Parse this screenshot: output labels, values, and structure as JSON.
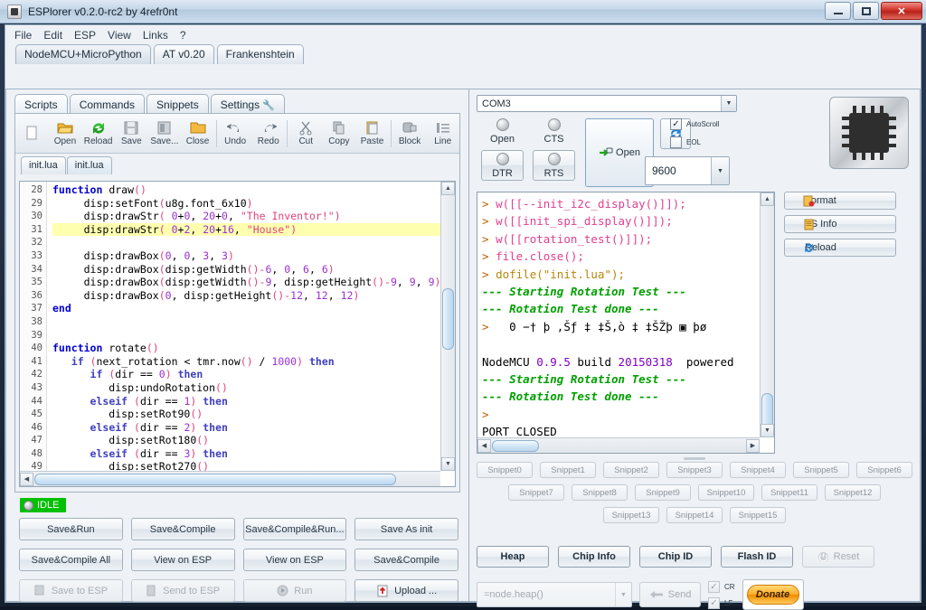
{
  "window": {
    "title": "ESPlorer v0.2.0-rc2 by 4refr0nt",
    "minimize_label": "minimize",
    "maximize_label": "maximize",
    "close_label": "✕"
  },
  "menubar": {
    "items": [
      "File",
      "Edit",
      "ESP",
      "View",
      "Links",
      "?"
    ]
  },
  "top_tabs": [
    {
      "label": "NodeMCU+MicroPython",
      "active": true
    },
    {
      "label": "AT v0.20",
      "active": false
    },
    {
      "label": "Frankenshtein",
      "active": false
    }
  ],
  "inner_tabs": [
    {
      "label": "Scripts",
      "active": true
    },
    {
      "label": "Commands",
      "active": false
    },
    {
      "label": "Snippets",
      "active": false
    },
    {
      "label": "Settings",
      "active": false,
      "icon": "wrench-icon"
    }
  ],
  "toolbar": [
    {
      "label": "",
      "icon": "new-file-icon"
    },
    {
      "label": "Open",
      "icon": "open-folder-icon"
    },
    {
      "label": "Reload",
      "icon": "reload-icon"
    },
    {
      "label": "Save",
      "icon": "save-icon"
    },
    {
      "label": "Save...",
      "icon": "save-as-icon"
    },
    {
      "label": "Close",
      "icon": "close-folder-icon"
    },
    {
      "label": "Undo",
      "icon": "undo-icon"
    },
    {
      "label": "Redo",
      "icon": "redo-icon"
    },
    {
      "label": "Cut",
      "icon": "scissors-icon"
    },
    {
      "label": "Copy",
      "icon": "copy-icon"
    },
    {
      "label": "Paste",
      "icon": "paste-icon"
    },
    {
      "label": "Block",
      "icon": "block-icon"
    },
    {
      "label": "Line",
      "icon": "line-icon"
    }
  ],
  "file_tabs": [
    {
      "label": "init.lua",
      "active": false
    },
    {
      "label": "init.lua",
      "active": true
    }
  ],
  "editor": {
    "first_line_number": 28,
    "highlight_line": 31,
    "lines": [
      {
        "n": 28,
        "text": "function draw()"
      },
      {
        "n": 29,
        "text": "     disp:setFont(u8g.font_6x10)"
      },
      {
        "n": 30,
        "text": "     disp:drawStr( 0+0, 20+0, \"The Inventor!\")"
      },
      {
        "n": 31,
        "text": "     disp:drawStr( 0+2, 20+16, \"House\")"
      },
      {
        "n": 32,
        "text": ""
      },
      {
        "n": 33,
        "text": "     disp:drawBox(0, 0, 3, 3)"
      },
      {
        "n": 34,
        "text": "     disp:drawBox(disp:getWidth()-6, 0, 6, 6)"
      },
      {
        "n": 35,
        "text": "     disp:drawBox(disp:getWidth()-9, disp:getHeight()-9, 9, 9)"
      },
      {
        "n": 36,
        "text": "     disp:drawBox(0, disp:getHeight()-12, 12, 12)"
      },
      {
        "n": 37,
        "text": "end"
      },
      {
        "n": 38,
        "text": ""
      },
      {
        "n": 39,
        "text": ""
      },
      {
        "n": 40,
        "text": "function rotate()"
      },
      {
        "n": 41,
        "text": "   if (next_rotation < tmr.now() / 1000) then"
      },
      {
        "n": 42,
        "text": "      if (dir == 0) then"
      },
      {
        "n": 43,
        "text": "         disp:undoRotation()"
      },
      {
        "n": 44,
        "text": "      elseif (dir == 1) then"
      },
      {
        "n": 45,
        "text": "         disp:setRot90()"
      },
      {
        "n": 46,
        "text": "      elseif (dir == 2) then"
      },
      {
        "n": 47,
        "text": "         disp:setRot180()"
      },
      {
        "n": 48,
        "text": "      elseif (dir == 3) then"
      },
      {
        "n": 49,
        "text": "         disp:setRot270()"
      }
    ]
  },
  "status": {
    "label": "IDLE",
    "color": "#00c000"
  },
  "action_buttons": {
    "row1": [
      "Save&Run",
      "Save&Compile",
      "Save&Compile&Run...",
      "Save As init"
    ],
    "row2": [
      "Save&Compile All",
      "View on ESP",
      "View on ESP",
      "Save&Compile"
    ],
    "row3": [
      {
        "label": "Save to ESP",
        "disabled": true,
        "icon": "save-esp-icon"
      },
      {
        "label": "Send to ESP",
        "disabled": true,
        "icon": "send-esp-icon"
      },
      {
        "label": "Run",
        "disabled": true,
        "icon": "run-icon"
      },
      {
        "label": "Upload ...",
        "disabled": false,
        "icon": "upload-icon"
      }
    ]
  },
  "serial": {
    "port": "COM3",
    "baud": "9600",
    "lamps": [
      {
        "label": "Open"
      },
      {
        "label": "CTS"
      },
      {
        "label": "DTR"
      },
      {
        "label": "RTS"
      }
    ],
    "open_button": "Open",
    "refresh_icon": "refresh-icon",
    "checkboxes": [
      {
        "label": "AutoScroll",
        "checked": true
      },
      {
        "label": "EOL",
        "checked": false
      }
    ]
  },
  "console": {
    "lines": [
      {
        "type": "cmd",
        "prompt": ">",
        "text": " w([[--init_i2c_display()]]);"
      },
      {
        "type": "cmd",
        "prompt": ">",
        "text": " w([[init_spi_display()]]);"
      },
      {
        "type": "cmd",
        "prompt": ">",
        "text": " w([[rotation_test()]]);"
      },
      {
        "type": "cmd",
        "prompt": ">",
        "text": " file.close();"
      },
      {
        "type": "cmd-str",
        "prompt": ">",
        "text": " dofile(\"init.lua\");"
      },
      {
        "type": "green",
        "text": "--- Starting Rotation Test ---"
      },
      {
        "type": "green",
        "text": "--- Rotation Test done ---"
      },
      {
        "type": "garbled",
        "prompt": ">",
        "text": "  0 −† þ ,Šƒ ‡ ‡Š‚ò ‡ ‡ŠŽþ ▣ þø"
      },
      {
        "type": "blank",
        "text": ""
      },
      {
        "type": "version",
        "text": "NodeMCU 0.9.5 build 20150318  powered"
      },
      {
        "type": "green",
        "text": "--- Starting Rotation Test ---"
      },
      {
        "type": "green",
        "text": "--- Rotation Test done ---"
      },
      {
        "type": "prompt-only",
        "text": ">"
      },
      {
        "type": "black",
        "text": "PORT CLOSED"
      }
    ]
  },
  "fs_buttons": [
    {
      "label": "Format",
      "icon": "format-icon"
    },
    {
      "label": "FS Info",
      "icon": "fs-info-icon"
    },
    {
      "label": "Reload",
      "icon": "reload-circular-icon"
    }
  ],
  "snippets": {
    "row1": [
      "Snippet0",
      "Snippet1",
      "Snippet2",
      "Snippet3",
      "Snippet4",
      "Snippet5",
      "Snippet6"
    ],
    "row2": [
      "Snippet7",
      "Snippet8",
      "Snippet9",
      "Snippet10",
      "Snippet11",
      "Snippet12"
    ],
    "row3": [
      "Snippet13",
      "Snippet14",
      "Snippet15"
    ]
  },
  "info_buttons": [
    {
      "label": "Heap",
      "disabled": false
    },
    {
      "label": "Chip Info",
      "disabled": false
    },
    {
      "label": "Chip ID",
      "disabled": false
    },
    {
      "label": "Flash ID",
      "disabled": false
    },
    {
      "label": "Reset",
      "disabled": true,
      "icon": "power-icon"
    }
  ],
  "command_bar": {
    "input_value": "=node.heap()",
    "send_label": "Send",
    "cr": {
      "label": "CR",
      "checked": true
    },
    "lf": {
      "label": "LF",
      "checked": true
    },
    "donate_label": "Donate"
  }
}
